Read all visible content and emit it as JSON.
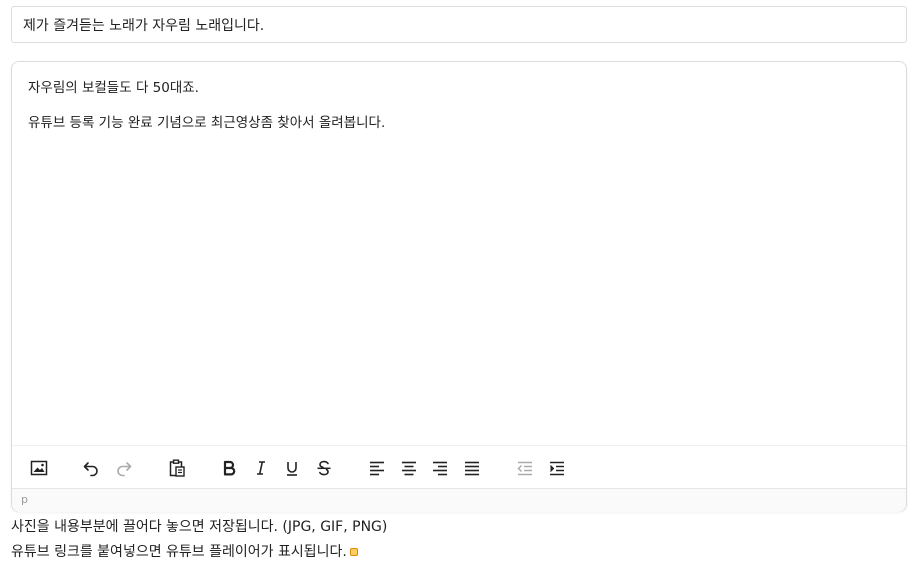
{
  "title_field": {
    "value": "제가 즐겨듣는 노래가 자우림 노래입니다."
  },
  "editor": {
    "paragraphs": [
      "자우림의 보컬들도 다 50대죠.",
      "유튜브 등록 기능 완료 기념으로 최근영상좀 찾아서 올려봅니다."
    ],
    "toolbar": {
      "icons": [
        "insert-image-icon",
        "undo-icon",
        "redo-icon",
        "paste-icon",
        "bold-icon",
        "italic-icon",
        "underline-icon",
        "strikethrough-icon",
        "align-left-icon",
        "align-center-icon",
        "align-right-icon",
        "align-justify-icon",
        "outdent-icon",
        "indent-icon"
      ]
    },
    "status_path": "p"
  },
  "help": {
    "line1": "사진을 내용부분에 끌어다 놓으면 저장됩니다. (JPG, GIF, PNG)",
    "line2": "유튜브 링크를 붙여넣으면 유튜브 플레이어가 표시됩니다."
  },
  "colors": {
    "border": "#dcdcdc",
    "icon": "#222222",
    "icon_disabled": "#aaaaaa",
    "marker": "#e08a00"
  }
}
